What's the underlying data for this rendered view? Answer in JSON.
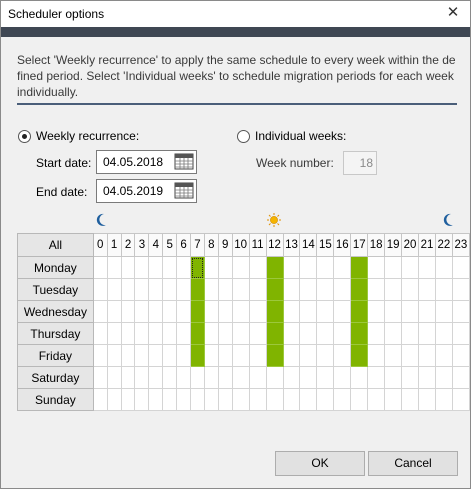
{
  "window": {
    "title": "Scheduler options",
    "close_glyph": "✕"
  },
  "description": "Select 'Weekly recurrence' to apply the same schedule to every week within the de fined period. Select 'Individual weeks' to schedule migration periods for each week individually.",
  "weekly": {
    "label": "Weekly recurrence:",
    "selected": true,
    "start_label": "Start date:",
    "start_value": "04.05.2018",
    "end_label": "End date:",
    "end_value": "04.05.2019"
  },
  "individual": {
    "label": "Individual weeks:",
    "selected": false,
    "week_label": "Week number:",
    "week_value": "18"
  },
  "grid": {
    "all_label": "All",
    "hours": [
      "0",
      "1",
      "2",
      "3",
      "4",
      "5",
      "6",
      "7",
      "8",
      "9",
      "10",
      "11",
      "12",
      "13",
      "14",
      "15",
      "16",
      "17",
      "18",
      "19",
      "20",
      "21",
      "22",
      "23"
    ],
    "days": [
      "Monday",
      "Tuesday",
      "Wednesday",
      "Thursday",
      "Friday",
      "Saturday",
      "Sunday"
    ],
    "active_hours_weekdays": [
      7,
      12,
      17
    ],
    "active_days": [
      "Monday",
      "Tuesday",
      "Wednesday",
      "Thursday",
      "Friday"
    ],
    "focused_cell": {
      "day": "Monday",
      "hour": 7
    },
    "active_color": "#80b400",
    "icons": [
      "moon-icon",
      "sun-icon",
      "moon-icon"
    ]
  },
  "buttons": {
    "ok": "OK",
    "cancel": "Cancel"
  }
}
